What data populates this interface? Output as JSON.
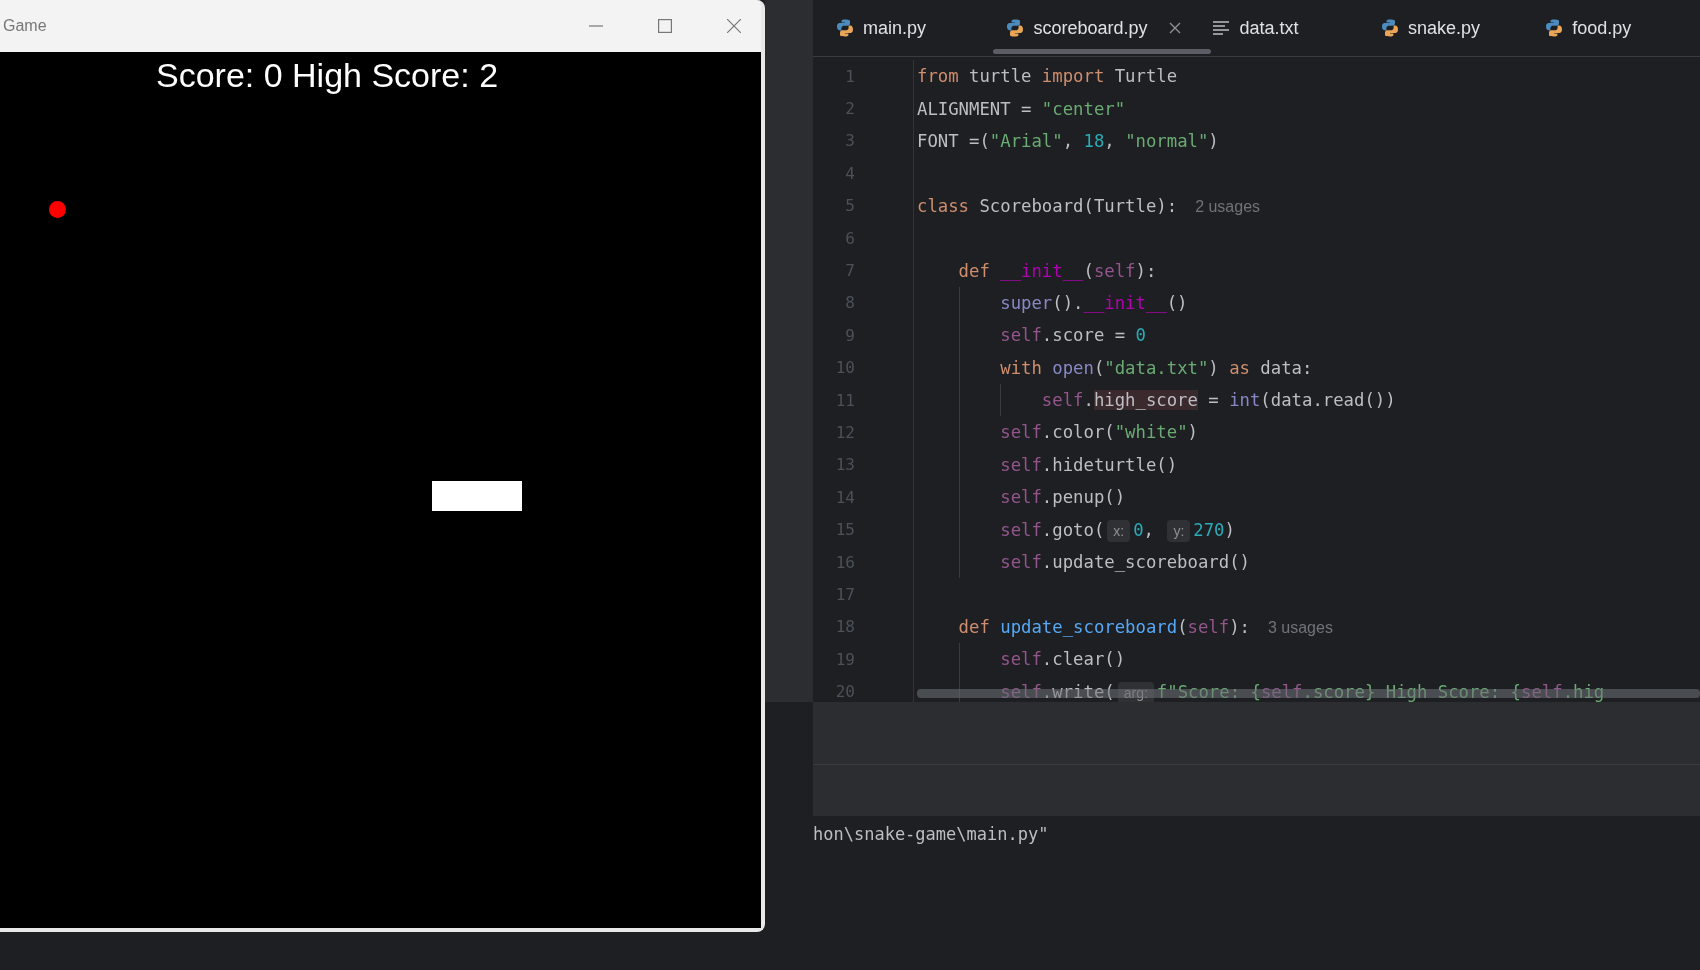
{
  "game_window": {
    "title": "Game",
    "score_text": "Score: 0 High Score: 2"
  },
  "tabs": [
    {
      "label": "main.py",
      "kind": "python",
      "selected": false
    },
    {
      "label": "scoreboard.py",
      "kind": "python",
      "selected": true
    },
    {
      "label": "data.txt",
      "kind": "text",
      "selected": false
    },
    {
      "label": "snake.py",
      "kind": "python",
      "selected": false
    },
    {
      "label": "food.py",
      "kind": "python",
      "selected": false
    }
  ],
  "code_lines": [
    {
      "number": "1",
      "tokens": [
        {
          "kind": "keyword",
          "text": "from"
        },
        {
          "kind": "plain",
          "text": " turtle "
        },
        {
          "kind": "keyword",
          "text": "import"
        },
        {
          "kind": "plain",
          "text": " Turtle"
        }
      ]
    },
    {
      "number": "2",
      "tokens": [
        {
          "kind": "plain",
          "text": "ALIGNMENT = "
        },
        {
          "kind": "string",
          "text": "\"center\""
        }
      ]
    },
    {
      "number": "3",
      "tokens": [
        {
          "kind": "plain",
          "text": "FONT =("
        },
        {
          "kind": "string",
          "text": "\"Arial\""
        },
        {
          "kind": "plain",
          "text": ", "
        },
        {
          "kind": "number",
          "text": "18"
        },
        {
          "kind": "plain",
          "text": ", "
        },
        {
          "kind": "string",
          "text": "\"normal\""
        },
        {
          "kind": "plain",
          "text": ")"
        }
      ]
    },
    {
      "number": "4"
    },
    {
      "number": "5",
      "tokens": [
        {
          "kind": "keyword",
          "text": "class"
        },
        {
          "kind": "plain",
          "text": " Scoreboard(Turtle):"
        },
        {
          "kind": "usage",
          "text": "2 usages"
        }
      ]
    },
    {
      "number": "6"
    },
    {
      "number": "7",
      "tokens": [
        {
          "kind": "keyword",
          "text": "    def"
        },
        {
          "kind": "dunder",
          "text": " __init__"
        },
        {
          "kind": "plain",
          "text": "("
        },
        {
          "kind": "self",
          "text": "self"
        },
        {
          "kind": "plain",
          "text": "):"
        }
      ]
    },
    {
      "number": "8",
      "tokens": [
        {
          "kind": "builtin",
          "text": "        super"
        },
        {
          "kind": "plain",
          "text": "()."
        },
        {
          "kind": "dunder",
          "text": "__init__"
        },
        {
          "kind": "plain",
          "text": "()"
        }
      ]
    },
    {
      "number": "9",
      "tokens": [
        {
          "kind": "self",
          "text": "        self"
        },
        {
          "kind": "plain",
          "text": ".score = "
        },
        {
          "kind": "number",
          "text": "0"
        }
      ]
    },
    {
      "number": "10",
      "tokens": [
        {
          "kind": "keyword",
          "text": "        with"
        },
        {
          "kind": "builtin",
          "text": " open"
        },
        {
          "kind": "plain",
          "text": "("
        },
        {
          "kind": "string",
          "text": "\"data.txt\""
        },
        {
          "kind": "plain",
          "text": ") "
        },
        {
          "kind": "keyword",
          "text": "as"
        },
        {
          "kind": "plain",
          "text": " data:"
        }
      ]
    },
    {
      "number": "11",
      "tokens": [
        {
          "kind": "self",
          "text": "            self"
        },
        {
          "kind": "plain",
          "text": "."
        },
        {
          "kind": "highlight",
          "text": "high_score"
        },
        {
          "kind": "plain",
          "text": " = "
        },
        {
          "kind": "builtin",
          "text": "int"
        },
        {
          "kind": "plain",
          "text": "(data.read())"
        }
      ]
    },
    {
      "number": "12",
      "tokens": [
        {
          "kind": "self",
          "text": "        self"
        },
        {
          "kind": "plain",
          "text": ".color("
        },
        {
          "kind": "string",
          "text": "\"white\""
        },
        {
          "kind": "plain",
          "text": ")"
        }
      ]
    },
    {
      "number": "13",
      "tokens": [
        {
          "kind": "self",
          "text": "        self"
        },
        {
          "kind": "plain",
          "text": ".hideturtle()"
        }
      ]
    },
    {
      "number": "14",
      "tokens": [
        {
          "kind": "self",
          "text": "        self"
        },
        {
          "kind": "plain",
          "text": ".penup()"
        }
      ]
    },
    {
      "number": "15",
      "tokens": [
        {
          "kind": "self",
          "text": "        self"
        },
        {
          "kind": "plain",
          "text": ".goto("
        },
        {
          "kind": "hint",
          "text": "x:"
        },
        {
          "kind": "number",
          "text": "0"
        },
        {
          "kind": "plain",
          "text": ", "
        },
        {
          "kind": "hint",
          "text": "y:"
        },
        {
          "kind": "number",
          "text": "270"
        },
        {
          "kind": "plain",
          "text": ")"
        }
      ]
    },
    {
      "number": "16",
      "tokens": [
        {
          "kind": "self",
          "text": "        self"
        },
        {
          "kind": "plain",
          "text": ".update_scoreboard()"
        }
      ]
    },
    {
      "number": "17"
    },
    {
      "number": "18",
      "tokens": [
        {
          "kind": "keyword",
          "text": "    def"
        },
        {
          "kind": "funcdef",
          "text": " update_scoreboard"
        },
        {
          "kind": "plain",
          "text": "("
        },
        {
          "kind": "self",
          "text": "self"
        },
        {
          "kind": "plain",
          "text": "):"
        },
        {
          "kind": "usage",
          "text": "3 usages"
        }
      ]
    },
    {
      "number": "19",
      "tokens": [
        {
          "kind": "self",
          "text": "        self"
        },
        {
          "kind": "plain",
          "text": ".clear()"
        }
      ]
    },
    {
      "number": "20",
      "tokens": [
        {
          "kind": "self",
          "text": "        self"
        },
        {
          "kind": "plain",
          "text": ".write("
        },
        {
          "kind": "hint",
          "text": "arg:"
        },
        {
          "kind": "string",
          "text": "f\"Score: {"
        },
        {
          "kind": "self",
          "text": "self"
        },
        {
          "kind": "string",
          "text": ".score} High Score: {"
        },
        {
          "kind": "self",
          "text": "self"
        },
        {
          "kind": "string",
          "text": ".hig"
        }
      ]
    }
  ],
  "terminal": {
    "line": "hon\\snake-game\\main.py\""
  }
}
